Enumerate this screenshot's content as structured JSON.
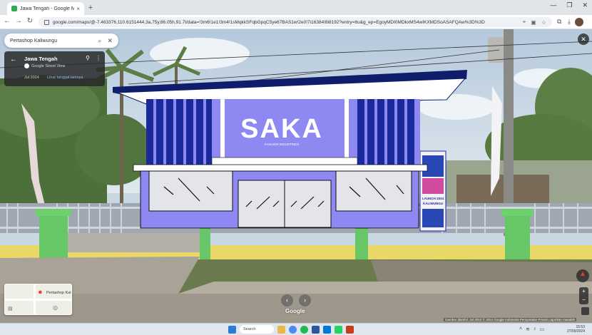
{
  "browser": {
    "tab_title": "Jawa Tengah - Google Maps",
    "tab_close": "×",
    "new_tab": "+",
    "url": "google.com/maps/@-7.463376,110.6151444,3a,75y,86.05h,91.7t/data=!3m6!1e1!3m4!1sMqkkSFqbGpqC5ye67BAS1w!2e0!7i16384!8i8192?entry=ttu&g_ep=EgoyMDI0MDkxMS4wIKXMDSoASAFQAw%3D%3D",
    "window_controls": [
      "—",
      "❐",
      "✕"
    ]
  },
  "maps": {
    "search_text": "Pertashop Kaliwungu",
    "place_name": "Jawa Tengah",
    "source_label": "Google Street View",
    "capture_date": "Jul 2024",
    "other_dates": "Lihat tanggal lainnya",
    "minimap_label": "Pertashop Kal",
    "logo": "Google",
    "attribution": "Gambar diambil: Jul 2024 © 2024 Google  Indonesia  Persyaratan  Privasi  Laporkan masalah",
    "zoom_in": "+",
    "zoom_out": "−"
  },
  "scene": {
    "brand": "SAKA",
    "tagline": "FASHION    INDUSTRIES",
    "banner_line1": "LAUNCH 2024",
    "banner_line2": "KALIWUNGU"
  },
  "taskbar": {
    "search_label": "Search",
    "time": "15:53",
    "date": "27/09/2024"
  },
  "colors": {
    "kiosk_lavender": "#8d88f2",
    "kiosk_navy": "#1a2a9c",
    "roof_navy": "#0f1d6b",
    "pillar_green": "#67c766",
    "wall_yellow": "#e9d867"
  }
}
